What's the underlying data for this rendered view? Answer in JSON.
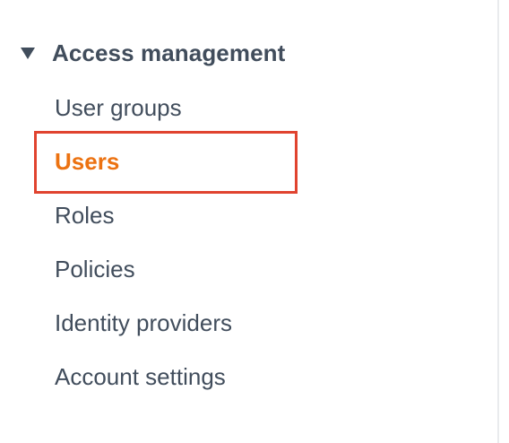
{
  "sidebar": {
    "section": {
      "title": "Access management",
      "expanded": true,
      "icon": "caret-down-icon"
    },
    "items": [
      {
        "label": "User groups",
        "active": false
      },
      {
        "label": "Users",
        "active": true
      },
      {
        "label": "Roles",
        "active": false
      },
      {
        "label": "Policies",
        "active": false
      },
      {
        "label": "Identity providers",
        "active": false
      },
      {
        "label": "Account settings",
        "active": false
      }
    ]
  },
  "colors": {
    "text": "#414d5c",
    "active": "#ec7211",
    "highlight_border": "#e0432f",
    "divider": "#e9ebed"
  }
}
